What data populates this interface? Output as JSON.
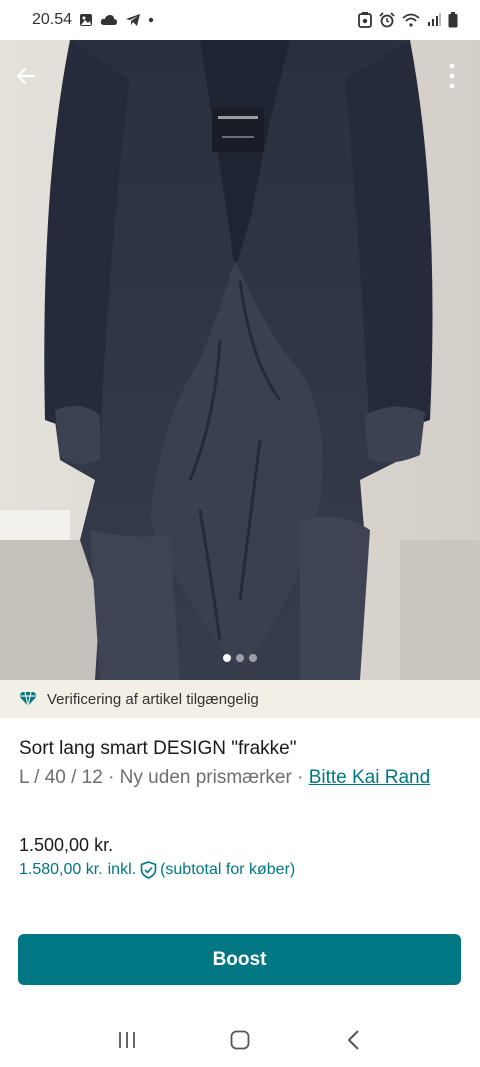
{
  "status_bar": {
    "time": "20.54",
    "left_icons": [
      "image-icon",
      "cloud-icon",
      "telegram-icon",
      "dot-icon"
    ],
    "right_icons": [
      "nfc-icon",
      "alarm-icon",
      "wifi-icon",
      "signal-icon",
      "battery-icon"
    ]
  },
  "photo": {
    "slide_count": 3,
    "active_slide": 1,
    "back_icon": "arrow-left-icon",
    "menu_icon": "more-vertical-icon"
  },
  "verification": {
    "icon": "diamond-icon",
    "text": "Verificering af artikel tilgængelig",
    "color": "#007782"
  },
  "item": {
    "title": "Sort lang smart DESIGN \"frakke\"",
    "meta": "L / 40 / 12 · Ny uden prismærker · ",
    "brand": "Bitte Kai Rand",
    "price": "1.500,00 kr.",
    "price_incl_amount": "1.580,00 kr.",
    "price_incl_label": "inkl.",
    "price_incl_suffix": "(subtotal for køber)"
  },
  "actions": {
    "boost_label": "Boost"
  },
  "navbar": {
    "icons": [
      "recent-apps-icon",
      "home-icon",
      "back-icon"
    ]
  },
  "colors": {
    "accent": "#007782",
    "banner_bg": "#f2efe6"
  }
}
